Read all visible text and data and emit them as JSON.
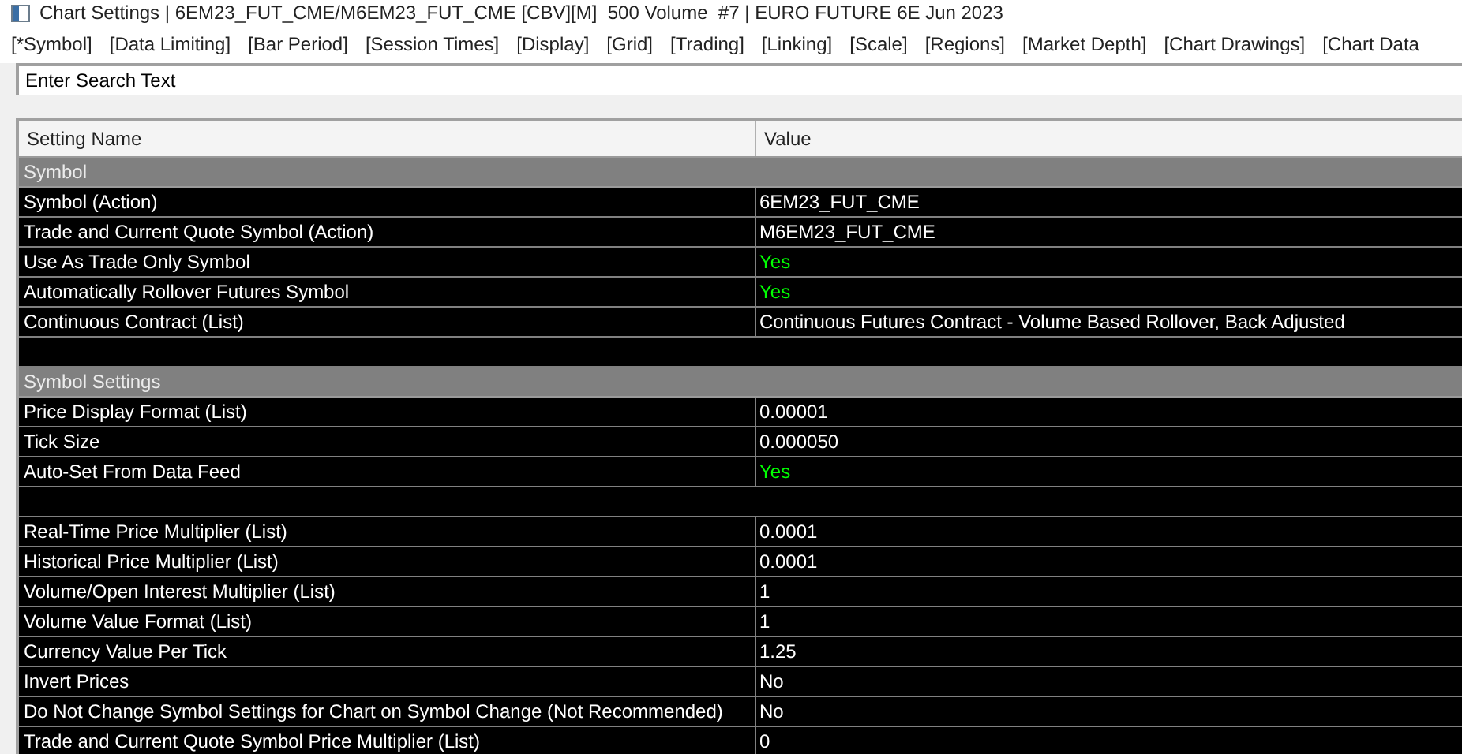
{
  "window": {
    "title": "Chart Settings | 6EM23_FUT_CME/M6EM23_FUT_CME [CBV][M]  500 Volume  #7 | EURO FUTURE 6E Jun 2023"
  },
  "tabs": [
    {
      "label": "[*Symbol]"
    },
    {
      "label": "[Data Limiting]"
    },
    {
      "label": "[Bar Period]"
    },
    {
      "label": "[Session Times]"
    },
    {
      "label": "[Display]"
    },
    {
      "label": "[Grid]"
    },
    {
      "label": "[Trading]"
    },
    {
      "label": "[Linking]"
    },
    {
      "label": "[Scale]"
    },
    {
      "label": "[Regions]"
    },
    {
      "label": "[Market Depth]"
    },
    {
      "label": "[Chart Drawings]"
    },
    {
      "label": "[Chart Data"
    }
  ],
  "search": {
    "placeholder": "Enter Search Text"
  },
  "table": {
    "columns": [
      "Setting Name",
      "Value"
    ],
    "rows": [
      {
        "kind": "section",
        "name": "Symbol"
      },
      {
        "kind": "setting",
        "name": "Symbol (Action)",
        "value": "6EM23_FUT_CME"
      },
      {
        "kind": "setting",
        "name": "Trade and Current Quote Symbol (Action)",
        "value": "M6EM23_FUT_CME"
      },
      {
        "kind": "setting",
        "name": "Use As Trade Only Symbol",
        "value": "Yes",
        "highlighted": true
      },
      {
        "kind": "setting",
        "name": "Automatically Rollover Futures Symbol",
        "value": "Yes",
        "highlighted": true
      },
      {
        "kind": "setting",
        "name": "Continuous Contract (List)",
        "value": "Continuous Futures Contract - Volume Based Rollover, Back Adjusted"
      },
      {
        "kind": "blank"
      },
      {
        "kind": "section",
        "name": "Symbol Settings"
      },
      {
        "kind": "setting",
        "name": "Price Display Format (List)",
        "value": "0.00001"
      },
      {
        "kind": "setting",
        "name": "Tick Size",
        "value": "0.000050"
      },
      {
        "kind": "setting",
        "name": "Auto-Set From Data Feed",
        "value": "Yes",
        "highlighted": true
      },
      {
        "kind": "blank"
      },
      {
        "kind": "setting",
        "name": "Real-Time Price Multiplier (List)",
        "value": "0.0001"
      },
      {
        "kind": "setting",
        "name": "Historical Price Multiplier (List)",
        "value": "0.0001"
      },
      {
        "kind": "setting",
        "name": "Volume/Open Interest Multiplier (List)",
        "value": "1"
      },
      {
        "kind": "setting",
        "name": "Volume Value Format (List)",
        "value": "1"
      },
      {
        "kind": "setting",
        "name": "Currency Value Per Tick",
        "value": "1.25"
      },
      {
        "kind": "setting",
        "name": "Invert Prices",
        "value": "No"
      },
      {
        "kind": "setting",
        "name": "Do Not Change Symbol Settings for Chart on Symbol Change (Not Recommended)",
        "value": "No"
      },
      {
        "kind": "setting",
        "name": "Trade and Current Quote Symbol Price Multiplier (List)",
        "value": "0"
      }
    ]
  }
}
